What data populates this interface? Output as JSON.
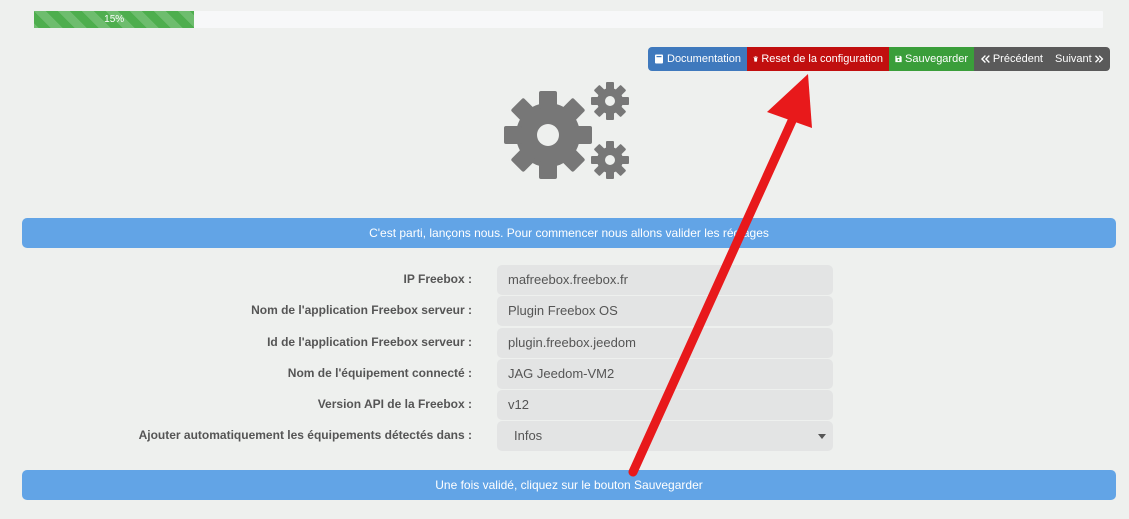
{
  "progress": {
    "label": "15%",
    "value": 0.15
  },
  "toolbar": {
    "documentation": "Documentation",
    "reset": "Reset de la configuration",
    "save": "Sauvegarder",
    "previous": "Précédent",
    "next": "Suivant"
  },
  "intro_banner": "C'est parti, lançons nous. Pour commencer nous allons valider les réglages",
  "form": {
    "ip_label": "IP Freebox :",
    "ip_value": "mafreebox.freebox.fr",
    "app_name_label": "Nom de l'application Freebox serveur :",
    "app_name_value": "Plugin Freebox OS",
    "app_id_label": "Id de l'application Freebox serveur :",
    "app_id_value": "plugin.freebox.jeedom",
    "device_label": "Nom de l'équipement connecté :",
    "device_value": "JAG Jeedom-VM2",
    "api_label": "Version API de la Freebox :",
    "api_value": "v12",
    "auto_add_label": "Ajouter automatiquement les équipements détectés dans :",
    "auto_add_value": "Infos"
  },
  "footer_banner": "Une fois validé, cliquez sur le bouton Sauvegarder",
  "colors": {
    "progress": "#4eae4e",
    "documentation": "#3f79bd",
    "reset": "#c10f0f",
    "save": "#3a9e3a",
    "nav": "#5a5a5a",
    "banner": "#62a4e6",
    "annotation_arrow": "#e8191b"
  },
  "icons": {
    "documentation": "book-icon",
    "reset": "trash-icon",
    "save": "floppy-icon",
    "previous": "double-chevron-left-icon",
    "next": "double-chevron-right-icon",
    "hero": "gears-icon"
  }
}
